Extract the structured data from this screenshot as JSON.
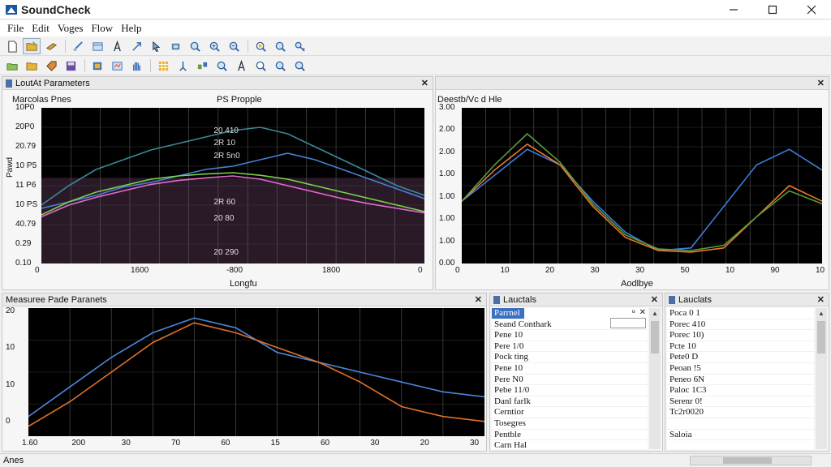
{
  "window": {
    "title": "SoundCheck",
    "controls": [
      "minimize-icon",
      "maximize-icon",
      "close-icon"
    ]
  },
  "menu": [
    "File",
    "Edit",
    "Voges",
    "Flow",
    "Help"
  ],
  "toolbar1": {
    "icons": [
      "new-doc-icon",
      "open-folder-icon",
      "edit-icon",
      "link-icon",
      "window-icon",
      "text-icon",
      "arrow-icon",
      "pointer-icon",
      "chip-icon",
      "search-icon",
      "zoom-in-icon",
      "zoom-out-icon",
      "zoom-fit-icon",
      "find-icon",
      "key-icon"
    ]
  },
  "toolbar2": {
    "icons": [
      "open-icon",
      "folder-icon",
      "tag-icon",
      "save-icon",
      "export-icon",
      "filter-icon",
      "hand-icon",
      "grid-icon",
      "pin-icon",
      "network-icon",
      "probe-icon",
      "text-icon",
      "magnify-icon",
      "zoom-in-icon",
      "search-icon"
    ]
  },
  "panels": {
    "top_left": {
      "title": "LoutAt Parameters",
      "subtitle_left": "Marcolas Pnes",
      "subtitle_mid": "PS Propple",
      "ylabel": "Pawd",
      "xlabel": "Longfu",
      "y_ticks": [
        "10P0",
        "20P0",
        "20.79",
        "10 P5",
        "11 P6",
        "10 PS",
        "40.79",
        "0.29",
        "0.10"
      ],
      "x_ticks": [
        "0",
        "1600",
        "-800",
        "1800",
        "0"
      ],
      "annotations": [
        "20 410",
        "2R 10",
        "2R 5n0",
        "2R 60",
        "20 80",
        "20 290"
      ],
      "close": "✕"
    },
    "top_right": {
      "title": "",
      "subtitle_left": "Deestb/Vc d Hle",
      "xlabel": "Aodlbye",
      "y_ticks": [
        "3.00",
        "2.00",
        "2.00",
        "1.00",
        "1.00",
        "1.00",
        "1.00",
        "0.00"
      ],
      "x_ticks": [
        "0",
        "10",
        "20",
        "30",
        "30",
        "50",
        "10",
        "90",
        "10"
      ],
      "close": "✕"
    },
    "bottom_left": {
      "title": "Measuree Pade Paranets",
      "y_ticks": [
        "20",
        "10",
        "10",
        "0"
      ],
      "x_ticks": [
        "1.60",
        "200",
        "30",
        "70",
        "60",
        "15",
        "60",
        "30",
        "20",
        "30"
      ],
      "close": "✕"
    },
    "list1": {
      "title": "Lauctals",
      "items": [
        "Parrnel",
        "Seand Conthark",
        "Pene 10",
        "Pere 1/0",
        "Pock ting",
        "Pene 10",
        "Pere N0",
        "Pebe 11/0",
        "Danl farlk",
        "Cerntior",
        "Tosegres",
        "Pentble",
        "Carn Hal"
      ],
      "close": "✕"
    },
    "list2": {
      "title": "Lauclats",
      "items": [
        "Poca 0 1",
        "Porec 410",
        "Porec 10)",
        "Pcte 10",
        "Pete0 D",
        "Peoan !5",
        "Peneo 6N",
        "Paloc 1C3",
        "Serenr 0!",
        "Tc2r0020",
        "",
        "Saloia"
      ],
      "close": "✕"
    }
  },
  "chart_data": [
    {
      "type": "line",
      "title": "LoutAt Parameters",
      "xlabel": "Longfu",
      "ylabel": "Pawd",
      "series": [
        {
          "name": "",
          "color": "#4a7fd6",
          "values": [
            0.85,
            0.95,
            1.05,
            1.18,
            1.25,
            1.35,
            1.45,
            1.5,
            1.6,
            1.7,
            1.6,
            1.45,
            1.3,
            1.15,
            1.0
          ]
        },
        {
          "name": "",
          "color": "#3a8a9a",
          "values": [
            0.9,
            1.2,
            1.45,
            1.6,
            1.75,
            1.85,
            1.95,
            2.05,
            2.1,
            2.0,
            1.8,
            1.6,
            1.4,
            1.2,
            1.05
          ]
        },
        {
          "name": "",
          "color": "#7ad34a",
          "values": [
            0.75,
            0.95,
            1.1,
            1.2,
            1.3,
            1.35,
            1.38,
            1.4,
            1.36,
            1.3,
            1.2,
            1.1,
            1.0,
            0.9,
            0.8
          ]
        },
        {
          "name": "",
          "color": "#e36ad0",
          "values": [
            0.72,
            0.9,
            1.02,
            1.12,
            1.22,
            1.28,
            1.32,
            1.35,
            1.3,
            1.2,
            1.1,
            1.0,
            0.92,
            0.85,
            0.78
          ]
        }
      ]
    },
    {
      "type": "line",
      "title": "Deestb/Vc d Hle",
      "xlabel": "Aodlbye",
      "series": [
        {
          "name": "",
          "color": "#3d7bd8",
          "values": [
            1.0,
            1.5,
            2.0,
            1.7,
            1.0,
            0.4,
            0.05,
            0.1,
            0.9,
            1.7,
            2.0,
            1.6
          ]
        },
        {
          "name": "",
          "color": "#ee7a2e",
          "values": [
            1.0,
            1.6,
            2.1,
            1.7,
            0.9,
            0.3,
            0.05,
            0.02,
            0.1,
            0.7,
            1.3,
            1.0
          ]
        },
        {
          "name": "",
          "color": "#5c9a3b",
          "values": [
            1.0,
            1.7,
            2.3,
            1.75,
            0.95,
            0.35,
            0.08,
            0.05,
            0.15,
            0.7,
            1.2,
            0.95
          ]
        }
      ]
    },
    {
      "type": "line",
      "title": "Measuree Pade Paranets",
      "series": [
        {
          "name": "",
          "color": "#4a86d8",
          "values": [
            2,
            8,
            14,
            19,
            22,
            20,
            15,
            13,
            11,
            9,
            7,
            6
          ]
        },
        {
          "name": "",
          "color": "#e0722a",
          "values": [
            0,
            5,
            11,
            17,
            21,
            19,
            16,
            13,
            9,
            4,
            2,
            1
          ]
        }
      ]
    }
  ],
  "status": {
    "text": "Anes"
  }
}
